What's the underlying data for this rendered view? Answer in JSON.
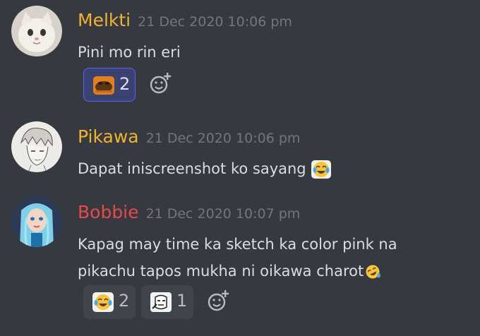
{
  "messages": [
    {
      "username": "Melkti",
      "username_color": "#f0b232",
      "timestamp": "21 Dec 2020 10:06 pm",
      "text": "Pini mo rin eri",
      "avatar_icon": "cat-avatar",
      "reactions": [
        {
          "emoji": "brown-creature-emoji",
          "count": "2",
          "selected": true
        }
      ]
    },
    {
      "username": "Pikawa",
      "username_color": "#f0b232",
      "timestamp": "21 Dec 2020 10:06 pm",
      "text": "Dapat iniscreenshot ko sayang",
      "trailing_emoji": "crying-laughing-emoji",
      "avatar_icon": "anime-sketch-avatar"
    },
    {
      "username": "Bobbie",
      "username_color": "#e8484b",
      "timestamp": "21 Dec 2020 10:07 pm",
      "text_line1": "Kapag may time ka sketch ka color pink na",
      "text_line2": "pikachu tapos mukha ni oikawa charot",
      "trailing_emoji": "rolling-laughing-emoji",
      "avatar_icon": "elsa-avatar",
      "reactions": [
        {
          "emoji": "crying-laughing-emoji",
          "count": "2",
          "selected": false
        },
        {
          "emoji": "meme-face-emoji",
          "count": "1",
          "selected": false
        }
      ]
    }
  ],
  "icons": {
    "add_reaction": "smiley-plus-icon"
  },
  "colors": {
    "background": "#36393f",
    "timestamp": "#72767d",
    "text": "#dcddde"
  }
}
